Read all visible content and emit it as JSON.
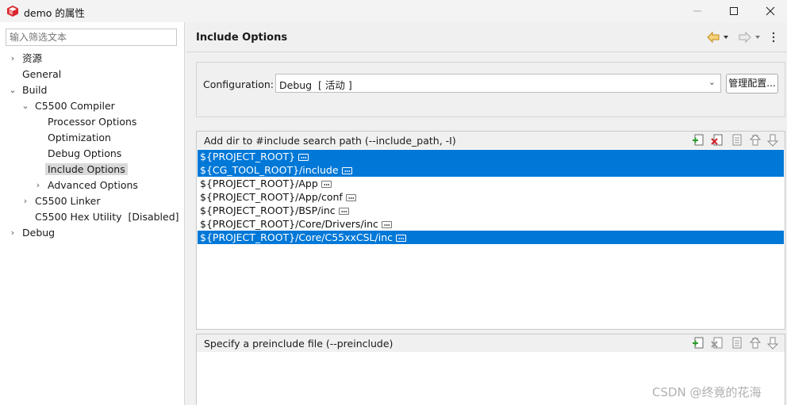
{
  "window": {
    "title": "demo 的属性"
  },
  "filter": {
    "placeholder": "输入筛选文本"
  },
  "tree": {
    "items": [
      {
        "label": "资源"
      },
      {
        "label": "General"
      },
      {
        "label": "Build"
      },
      {
        "label": "C5500 Compiler"
      },
      {
        "label": "Processor Options"
      },
      {
        "label": "Optimization"
      },
      {
        "label": "Debug Options"
      },
      {
        "label": "Include Options"
      },
      {
        "label": "Advanced Options"
      },
      {
        "label": "C5500 Linker"
      },
      {
        "label": "C5500 Hex Utility  [Disabled]"
      },
      {
        "label": "Debug"
      }
    ]
  },
  "page": {
    "title": "Include Options"
  },
  "configuration": {
    "label": "Configuration:",
    "value": "Debug  [ 活动 ]",
    "manage_label": "管理配置..."
  },
  "include_paths": {
    "label": "Add dir to #include search path (--include_path, -I)",
    "rows": [
      "${PROJECT_ROOT}",
      "${CG_TOOL_ROOT}/include",
      "${PROJECT_ROOT}/App",
      "${PROJECT_ROOT}/App/conf",
      "${PROJECT_ROOT}/BSP/inc",
      "${PROJECT_ROOT}/Core/Drivers/inc",
      "${PROJECT_ROOT}/Core/C55xxCSL/inc"
    ]
  },
  "preinclude": {
    "label": "Specify a preinclude file (--preinclude)"
  },
  "watermark": {
    "text": "CSDN @终竟的花海"
  },
  "colors": {
    "selection": "#0078d7",
    "tree_selected": "#d9d9d9"
  }
}
